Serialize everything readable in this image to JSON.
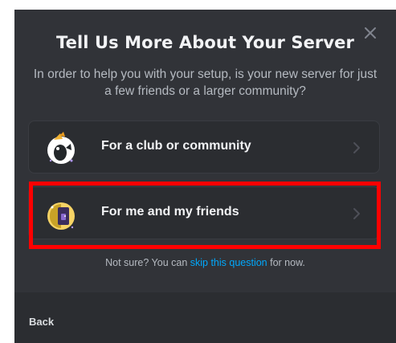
{
  "dialog": {
    "title": "Tell Us More About Your Server",
    "subtitle": "In order to help you with your setup, is your new server for just a few friends or a larger community?",
    "close_icon": "close-icon"
  },
  "options": [
    {
      "label": "For a club or community",
      "icon": "club-community-icon",
      "chevron": "chevron-right-icon"
    },
    {
      "label": "For me and my friends",
      "icon": "me-and-friends-icon",
      "chevron": "chevron-right-icon",
      "highlighted": true
    }
  ],
  "help": {
    "prefix": "Not sure? You can ",
    "link": "skip this question",
    "suffix": " for now."
  },
  "footer": {
    "back_label": "Back"
  },
  "colors": {
    "modal_background": "#313338",
    "card_background": "#2b2d31",
    "link": "#00a8fc",
    "highlight": "#ff0000"
  }
}
